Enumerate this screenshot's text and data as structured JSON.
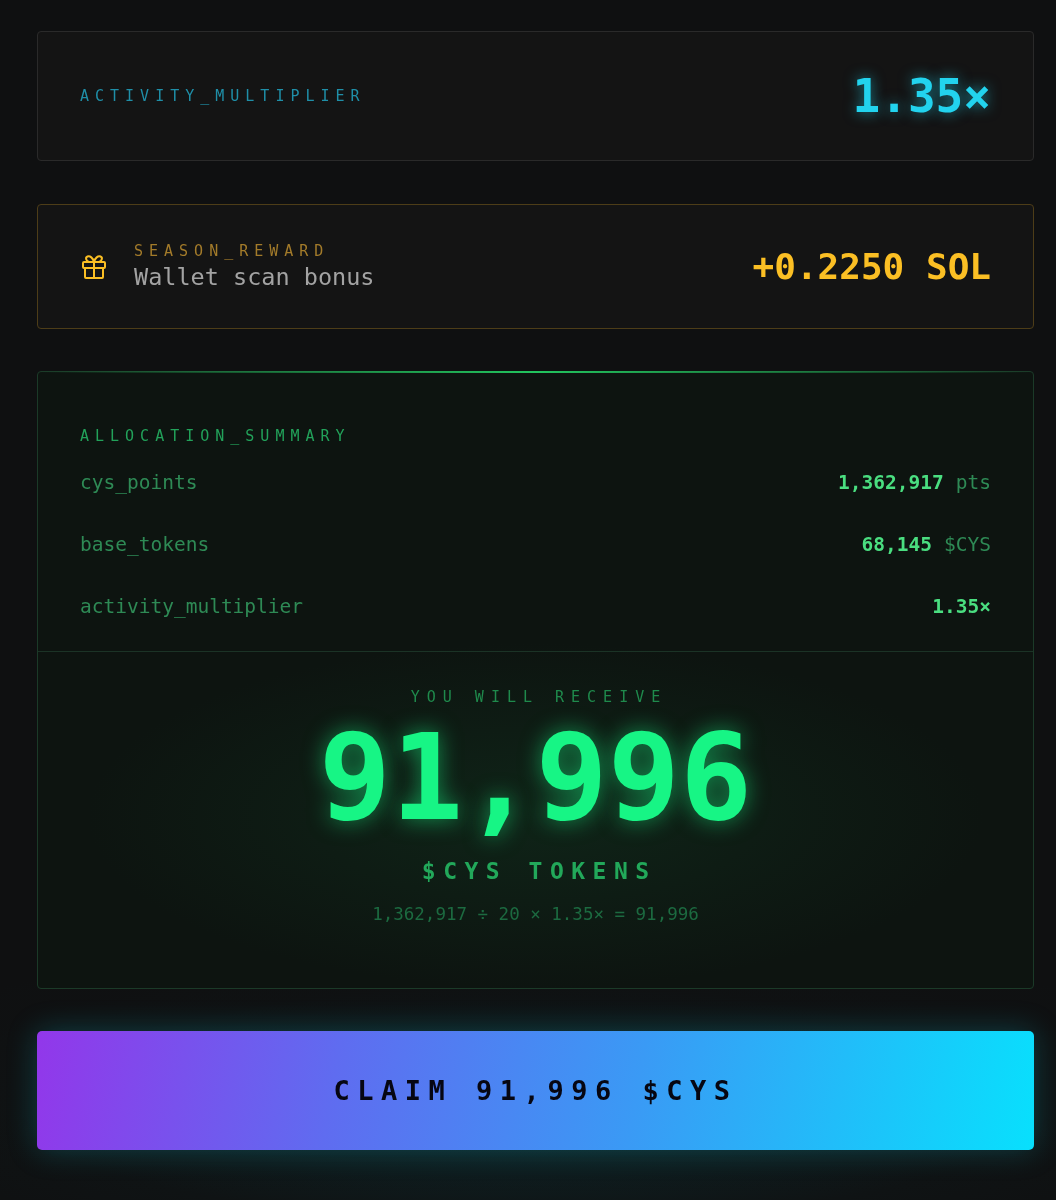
{
  "multiplier_card": {
    "label": "ACTIVITY_MULTIPLIER",
    "value": "1.35×"
  },
  "season_reward": {
    "label": "SEASON_REWARD",
    "description": "Wallet scan bonus",
    "value": "+0.2250 SOL"
  },
  "allocation_summary": {
    "title": "ALLOCATION_SUMMARY",
    "rows": [
      {
        "label": "cys_points",
        "value": "1,362,917",
        "unit": "pts"
      },
      {
        "label": "base_tokens",
        "value": "68,145",
        "unit": "$CYS"
      },
      {
        "label": "activity_multiplier",
        "value": "1.35×"
      }
    ],
    "receive": {
      "caption": "YOU WILL RECEIVE",
      "amount": "91,996",
      "unit": "$CYS TOKENS",
      "formula": "1,362,917 ÷ 20 × 1.35× = 91,996"
    }
  },
  "claim_button": {
    "label": "CLAIM 91,996 $CYS"
  }
}
